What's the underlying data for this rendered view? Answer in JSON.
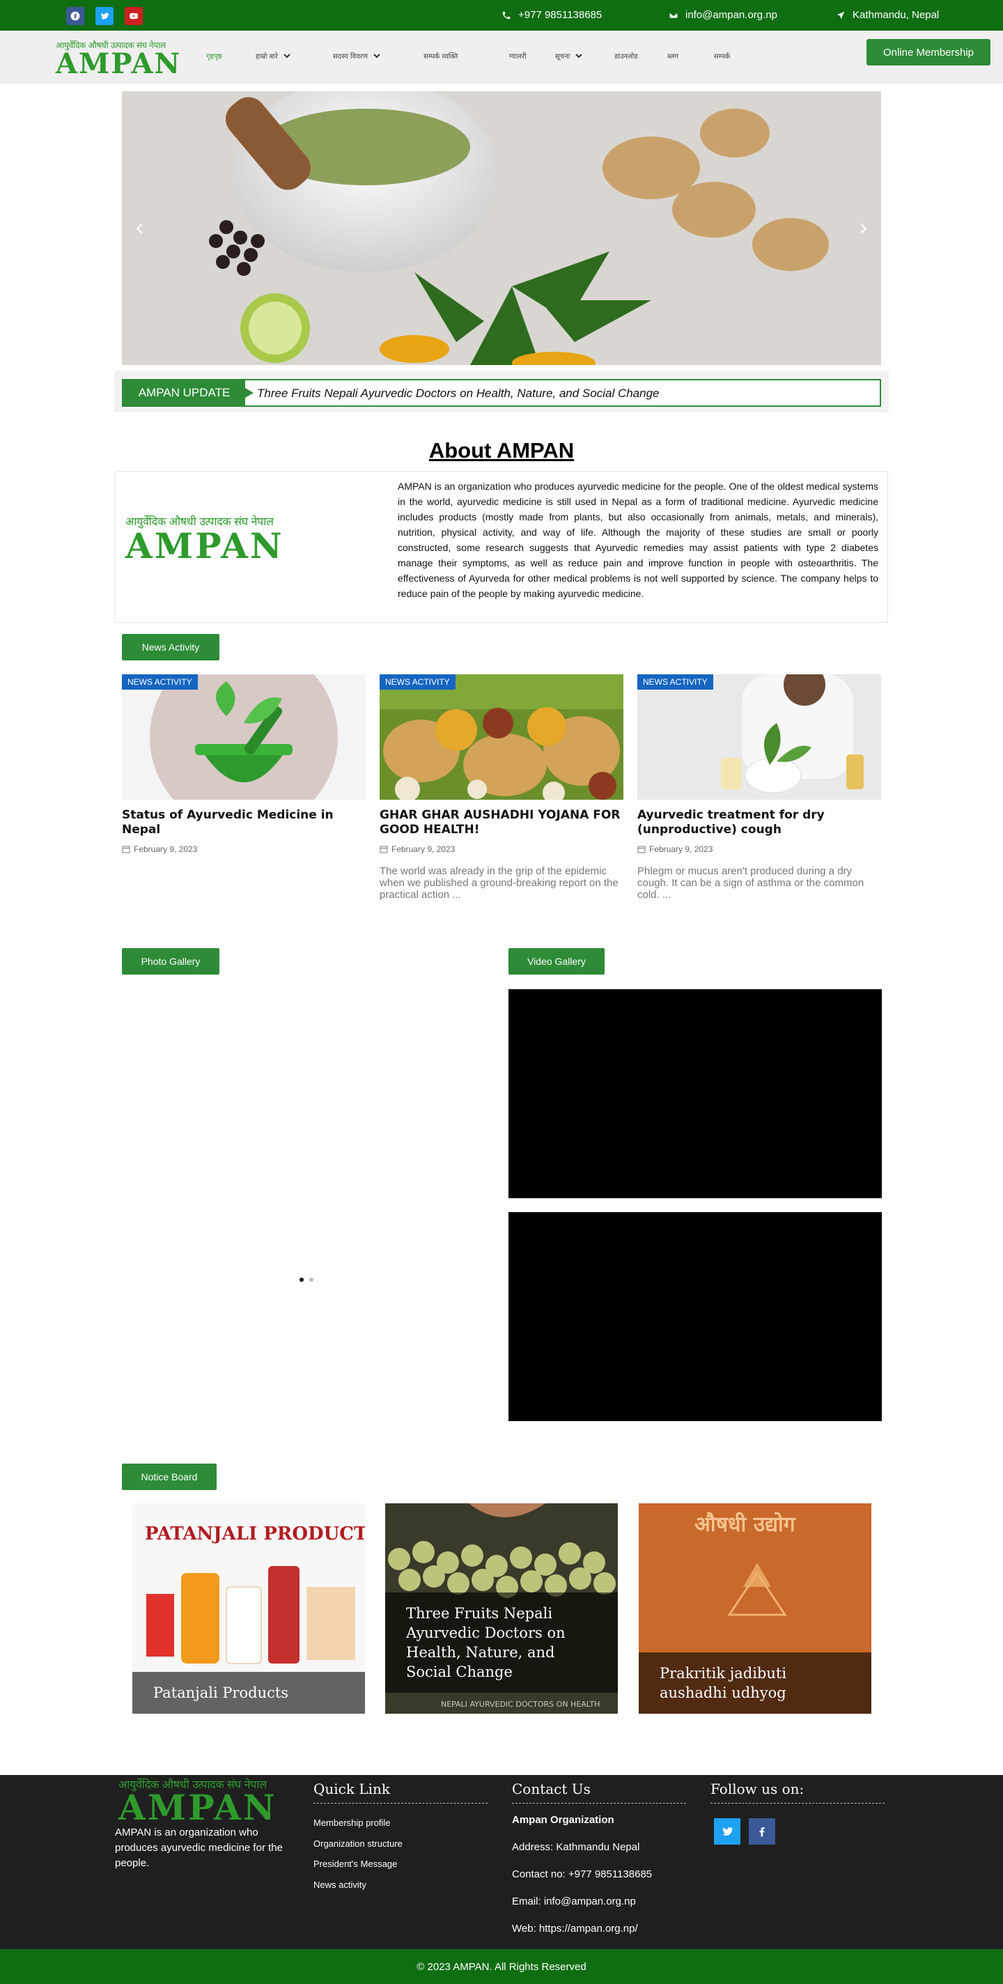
{
  "topbar": {
    "social": [
      {
        "icon": "facebook-icon",
        "color": "#3b5998"
      },
      {
        "icon": "twitter-icon",
        "color": "#1da1f2"
      },
      {
        "icon": "youtube-icon",
        "color": "#cd201f"
      }
    ],
    "phone": "+977 9851138685",
    "email": "info@ampan.org.np",
    "location": "Kathmandu, Nepal",
    "bg_color": "#0f6d12"
  },
  "header": {
    "logo_np": "आयुर्वेदिक औषधी उत्पादक संघ नेपाल",
    "logo_en": "AMPAN",
    "nav": [
      {
        "label": "गृहपृष्ठ",
        "dropdown": false,
        "active": true
      },
      {
        "label": "हाम्रो बारे",
        "dropdown": true
      },
      {
        "label": "सदस्य विवरण",
        "dropdown": true
      },
      {
        "label": "सम्पर्क व्यक्ति",
        "dropdown": false
      },
      {
        "label": "ग्यालरी",
        "dropdown": false
      },
      {
        "label": "सूचना",
        "dropdown": true
      },
      {
        "label": "डाउनलोड",
        "dropdown": false
      },
      {
        "label": "ब्लग",
        "dropdown": false
      },
      {
        "label": "सम्पर्क",
        "dropdown": false
      }
    ],
    "membership_button": "Online Membership"
  },
  "slider": {
    "prev": "‹",
    "next": "›"
  },
  "ticker": {
    "label": "AMPAN UPDATE",
    "text": "Three Fruits Nepali Ayurvedic Doctors on Health, Nature, and Social Change"
  },
  "about": {
    "title": "About AMPAN",
    "logo_np": "आयुर्वेदिक औषधी उत्पादक संघ नेपाल",
    "logo_en": "AMPAN",
    "text": "AMPAN is an organization who produces ayurvedic medicine for the people. One of the oldest medical systems in the world, ayurvedic medicine is still used in Nepal as a form of traditional medicine. Ayurvedic medicine includes products (mostly made from plants, but also occasionally from animals, metals, and minerals), nutrition, physical activity, and way of life. Although the majority of these studies are small or poorly constructed, some research suggests that Ayurvedic remedies may assist patients with type 2 diabetes manage their symptoms, as well as reduce pain and improve function in people with osteoarthritis. The effectiveness of Ayurveda for other medical problems is not well supported by science. The company helps to reduce pain of the people by making ayurvedic medicine."
  },
  "news": {
    "section_label": "News Activity",
    "cards": [
      {
        "badge": "NEWS ACTIVITY",
        "title": "Status of Ayurvedic Medicine in Nepal",
        "date": "February 9, 2023",
        "excerpt": ""
      },
      {
        "badge": "NEWS ACTIVITY",
        "title": "GHAR GHAR AUSHADHI YOJANA FOR GOOD HEALTH!",
        "date": "February 9, 2023",
        "excerpt": "The world was already in the grip of the epidemic when we published a ground-breaking report on the practical action ..."
      },
      {
        "badge": "NEWS ACTIVITY",
        "title": "Ayurvedic treatment for dry (unproductive) cough",
        "date": "February 9, 2023",
        "excerpt": "Phlegm or mucus aren't produced during a dry cough. It can be a sign of asthma or the common cold. ..."
      }
    ]
  },
  "gallery": {
    "photo_label": "Photo Gallery",
    "video_label": "Video Gallery"
  },
  "notice_board": {
    "label": "Notice Board",
    "items": [
      {
        "title": "Patanjali Products",
        "image_text": "PATANJALI PRODUCT"
      },
      {
        "title": "Three Fruits Nepali Ayurvedic Doctors on Health, Nature, and Social Change",
        "image_text": "NEPALI AYURVEDIC DOCTORS ON HEALTH"
      },
      {
        "title": "Prakritik jadibuti aushadhi udhyog",
        "image_text": "औषधी उद्योग"
      }
    ]
  },
  "footer": {
    "logo_np": "आयुर्वेदिक औषधी उत्पादक संघ नेपाल",
    "logo_en": "AMPAN",
    "about": "AMPAN is an organization  who produces ayurvedic medicine for the people.",
    "quick_link_title": "Quick Link",
    "quick_links": [
      "Membership profile",
      "Organization structure",
      "President's Message",
      "News activity"
    ],
    "contact_title": "Contact Us",
    "contact_org": "Ampan Organization",
    "contact_address": "Address: Kathmandu Nepal",
    "contact_phone": "Contact no: +977 9851138685",
    "contact_email": "Email: info@ampan.org.np",
    "contact_web": "Web: https://ampan.org.np/",
    "follow_title": "Follow us on:",
    "follow_social": [
      {
        "icon": "twitter-icon",
        "color": "#1da1f2"
      },
      {
        "icon": "facebook-icon",
        "color": "#3b5998"
      }
    ],
    "copyright": "© 2023 AMPAN. All Rights Reserved"
  }
}
